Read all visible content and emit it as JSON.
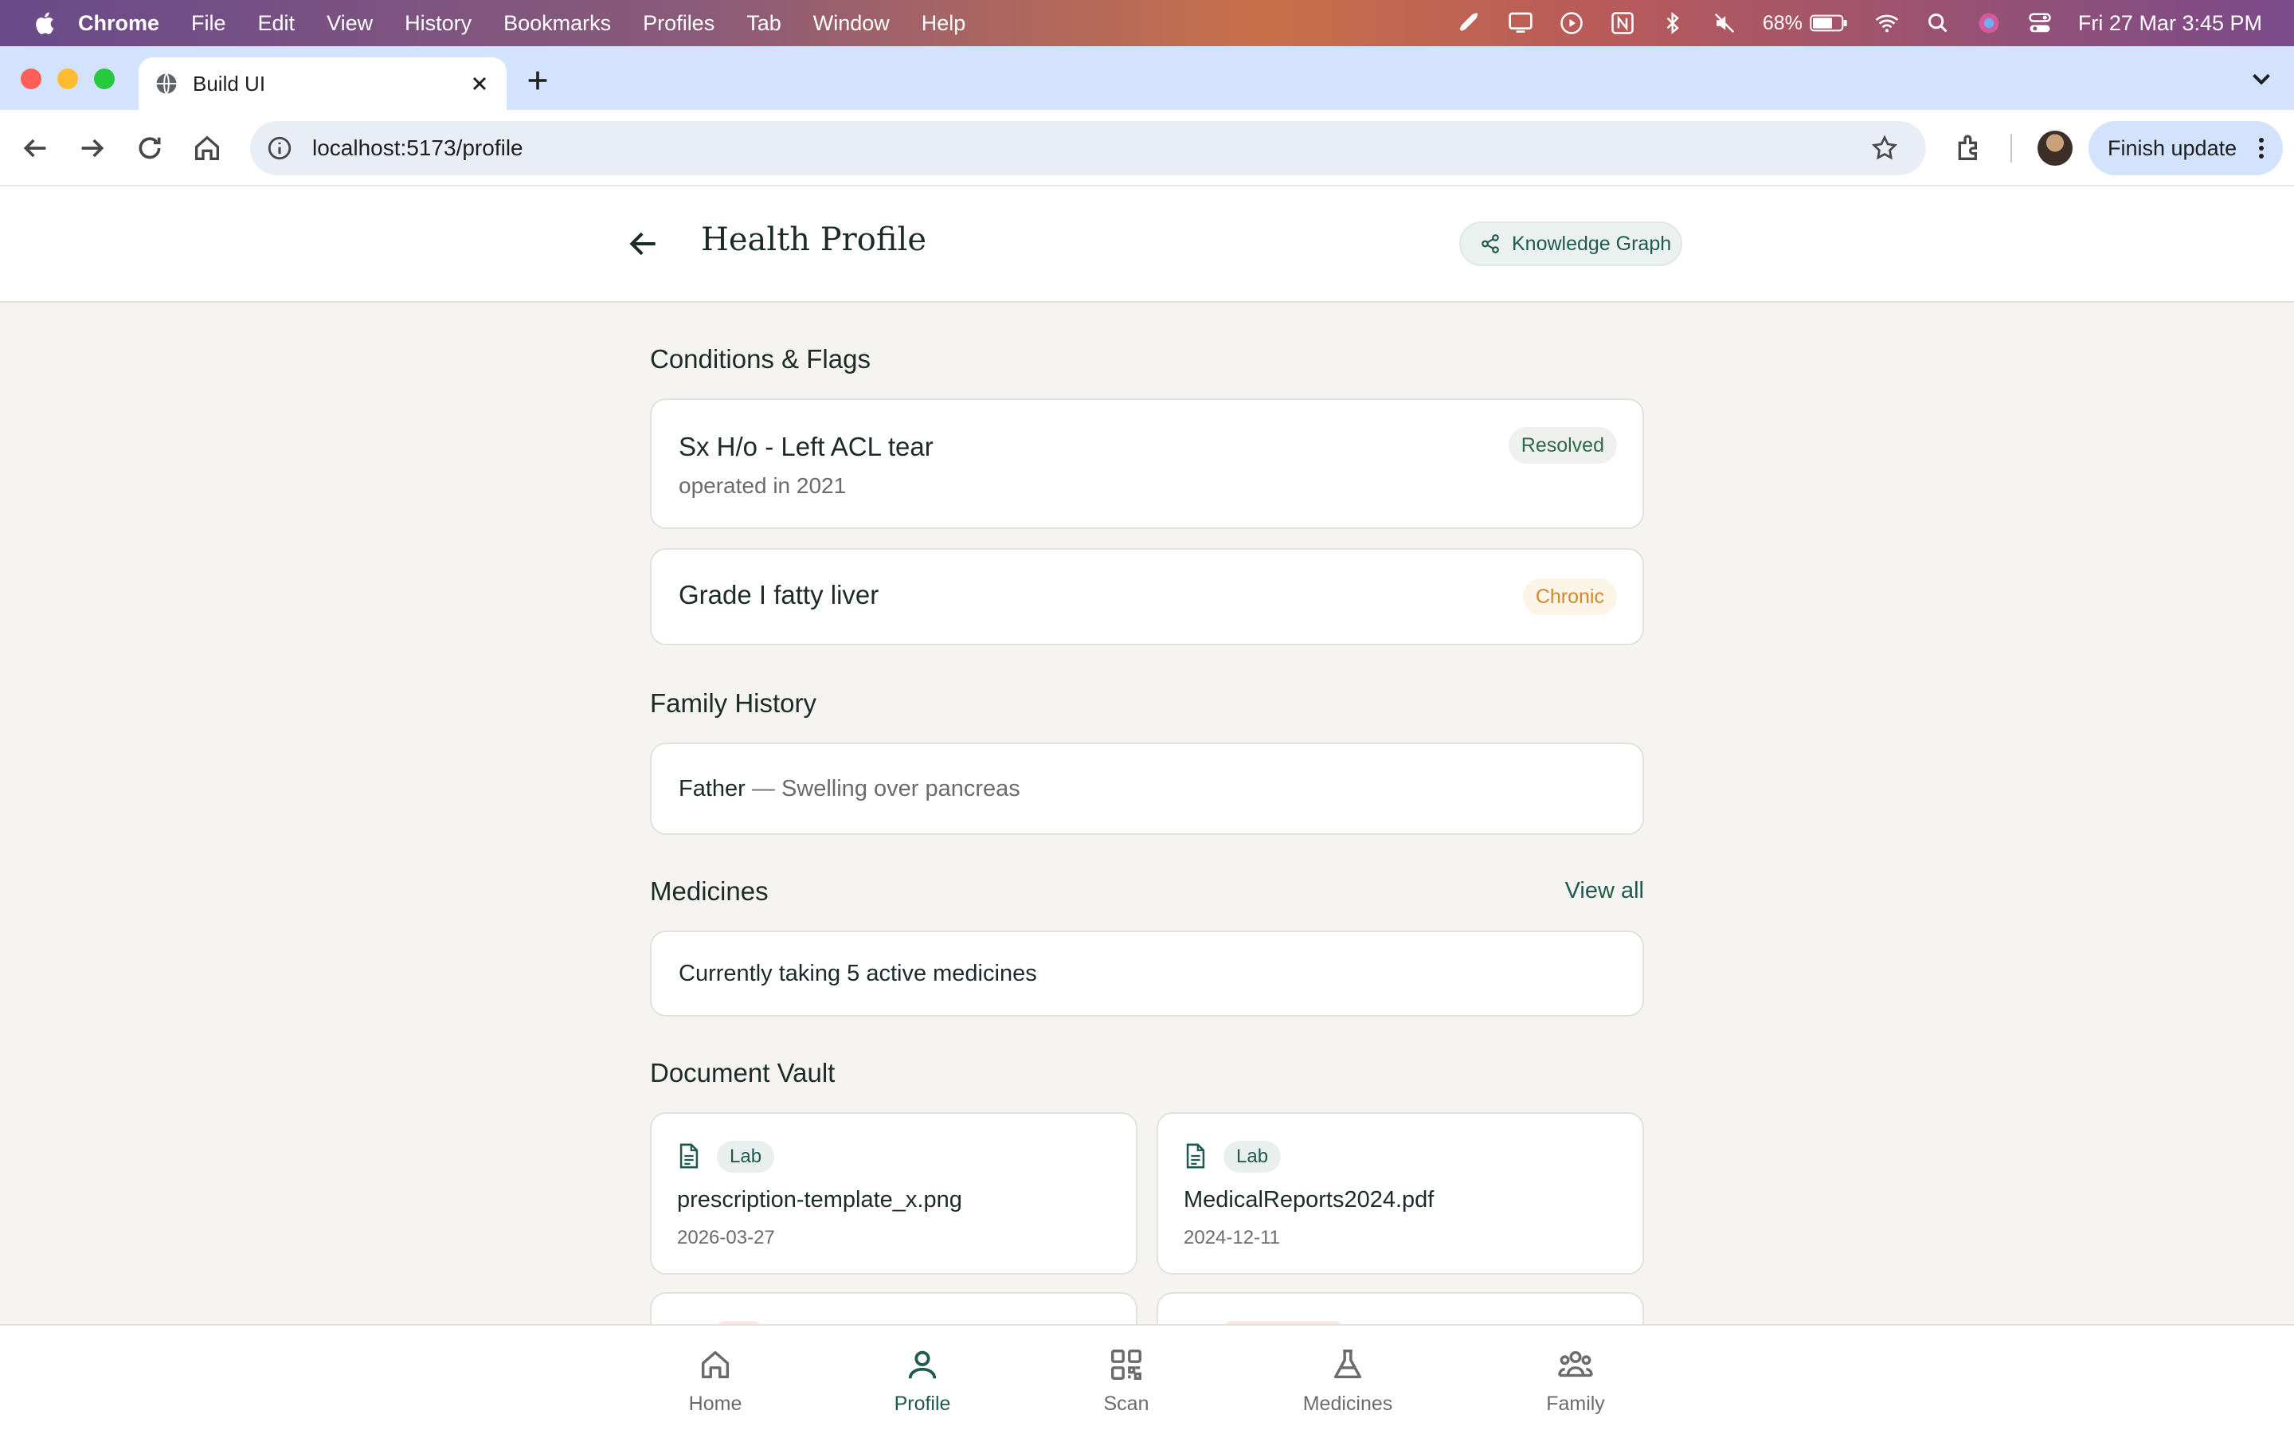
{
  "menubar": {
    "app_name": "Chrome",
    "items": [
      "File",
      "Edit",
      "View",
      "History",
      "Bookmarks",
      "Profiles",
      "Tab",
      "Window",
      "Help"
    ],
    "battery": "68%",
    "datetime": "Fri 27 Mar  3:45 PM"
  },
  "browser": {
    "tab_title": "Build UI",
    "url": "localhost:5173/profile",
    "update_button": "Finish update"
  },
  "header": {
    "title": "Health Profile",
    "knowledge_graph_label": "Knowledge Graph"
  },
  "conditions": {
    "title": "Conditions & Flags",
    "items": [
      {
        "name": "Sx H/o - Left ACL tear",
        "detail": "operated in 2021",
        "status": "Resolved"
      },
      {
        "name": "Grade I fatty liver",
        "status": "Chronic"
      }
    ]
  },
  "family_history": {
    "title": "Family History",
    "items": [
      {
        "relation": "Father",
        "condition": " — Swelling over pancreas"
      }
    ]
  },
  "medicines": {
    "title": "Medicines",
    "view_all": "View all",
    "summary": "Currently taking 5 active medicines"
  },
  "documents": {
    "title": "Document Vault",
    "items": [
      {
        "tag": "Lab",
        "name": "prescription-template_x.png",
        "date": "2026-03-27"
      },
      {
        "tag": "Lab",
        "name": "MedicalReports2024.pdf",
        "date": "2024-12-11"
      }
    ]
  },
  "bottom_nav": {
    "items": [
      {
        "label": "Home",
        "icon": "home-icon"
      },
      {
        "label": "Profile",
        "icon": "user-icon",
        "active": true
      },
      {
        "label": "Scan",
        "icon": "qr-scan-icon"
      },
      {
        "label": "Medicines",
        "icon": "flask-icon"
      },
      {
        "label": "Family",
        "icon": "family-icon"
      }
    ]
  },
  "colors": {
    "accent": "#1f5a50",
    "background": "#f5f4f0",
    "resolved": "#2f6b4a",
    "chronic": "#d08a2a"
  }
}
